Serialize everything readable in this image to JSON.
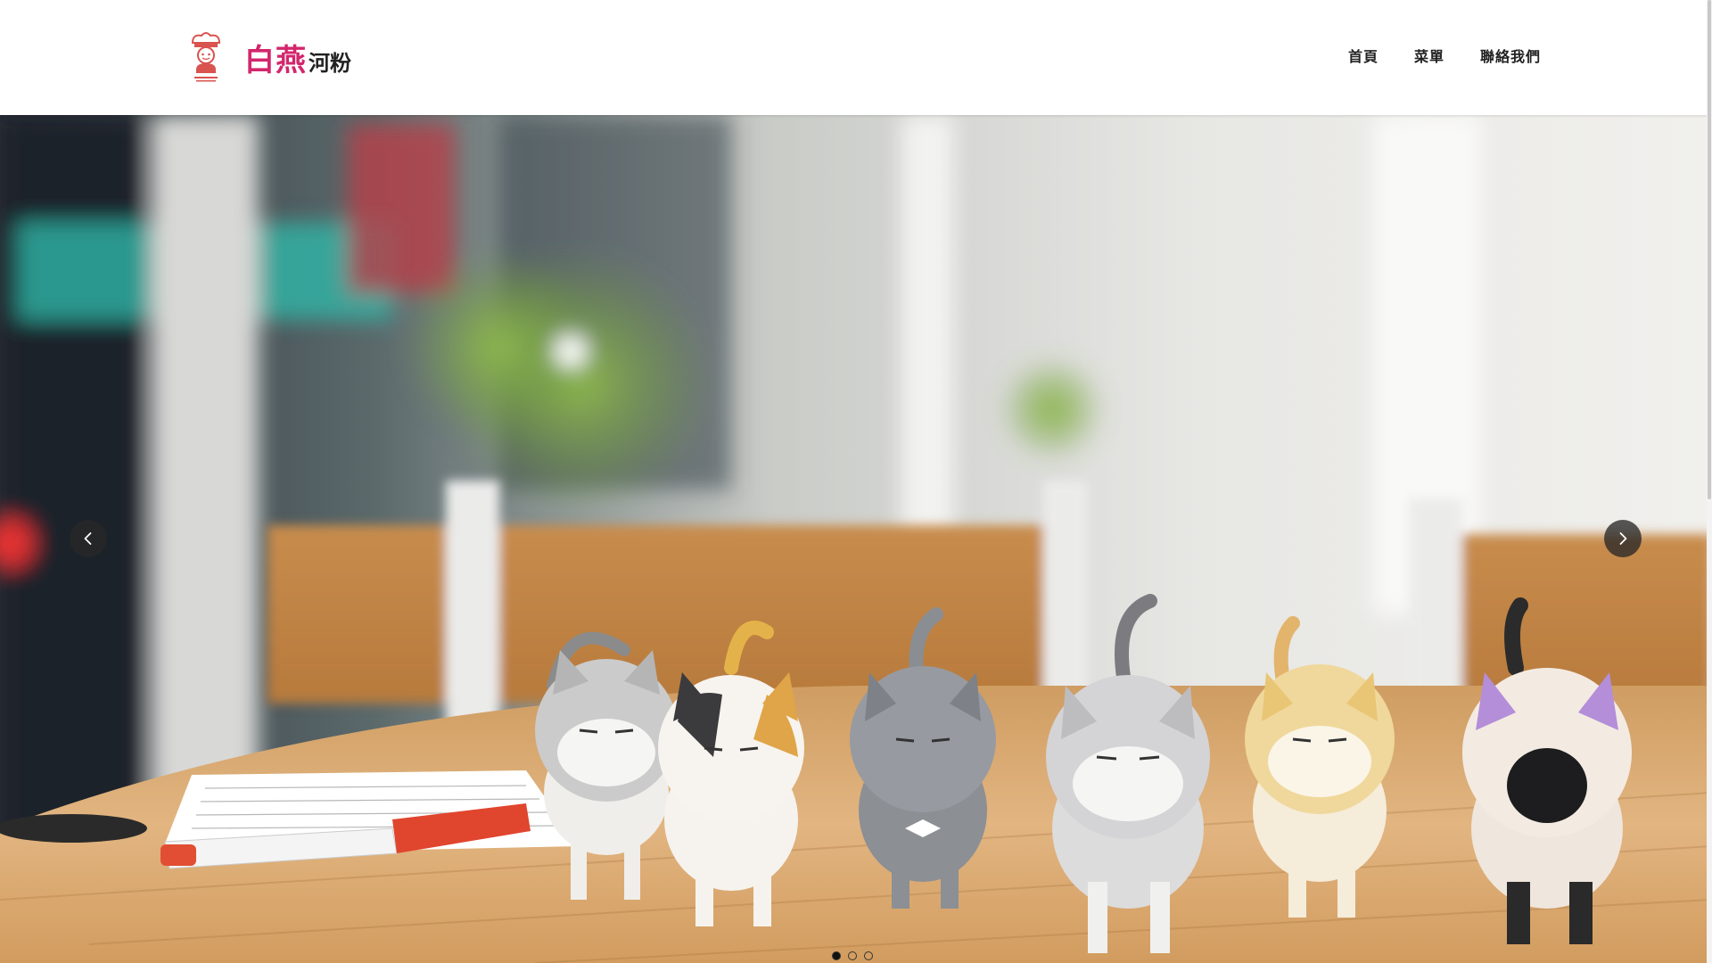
{
  "header": {
    "brand_main": "白燕",
    "brand_sub": "河粉",
    "logo_icon": "chef-mascot-logo-icon",
    "brand_color": "#d3266c",
    "nav": [
      {
        "label": "首頁"
      },
      {
        "label": "菜單"
      },
      {
        "label": "聯絡我們"
      }
    ]
  },
  "hero": {
    "slide_image": "cat-figurines-on-table-photo",
    "prev_icon": "chevron-left-icon",
    "next_icon": "chevron-right-icon",
    "slide_count": 3,
    "active_slide": 1
  }
}
